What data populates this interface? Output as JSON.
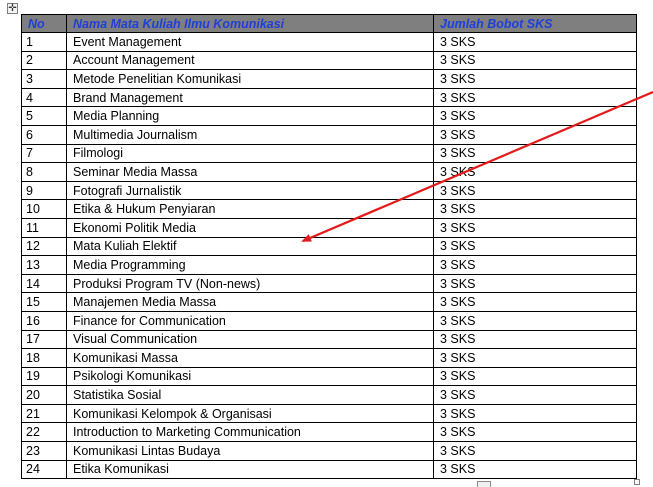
{
  "table": {
    "headers": {
      "no": "No",
      "name": "Nama Mata Kuliah Ilmu Komunikasi",
      "sks": "Jumlah Bobot SKS"
    },
    "rows": [
      {
        "no": "1",
        "name": "Event Management",
        "sks": "3 SKS"
      },
      {
        "no": "2",
        "name": "Account Management",
        "sks": "3 SKS"
      },
      {
        "no": "3",
        "name": "Metode Penelitian Komunikasi",
        "sks": "3 SKS"
      },
      {
        "no": "4",
        "name": "Brand Management",
        "sks": "3 SKS"
      },
      {
        "no": "5",
        "name": "Media Planning",
        "sks": "3 SKS"
      },
      {
        "no": "6",
        "name": "Multimedia Journalism",
        "sks": "3 SKS"
      },
      {
        "no": "7",
        "name": "Filmologi",
        "sks": "3 SKS"
      },
      {
        "no": "8",
        "name": "Seminar Media Massa",
        "sks": "3 SKS"
      },
      {
        "no": "9",
        "name": "Fotografi Jurnalistik",
        "sks": "3 SKS"
      },
      {
        "no": "10",
        "name": "Etika & Hukum Penyiaran",
        "sks": "3 SKS"
      },
      {
        "no": "11",
        "name": "Ekonomi Politik Media",
        "sks": "3 SKS"
      },
      {
        "no": "12",
        "name": "Mata Kuliah Elektif",
        "sks": "3 SKS"
      },
      {
        "no": "13",
        "name": "Media Programming",
        "sks": "3 SKS"
      },
      {
        "no": "14",
        "name": "Produksi Program TV (Non-news)",
        "sks": "3 SKS"
      },
      {
        "no": "15",
        "name": "Manajemen Media Massa",
        "sks": "3 SKS"
      },
      {
        "no": "16",
        "name": "Finance for Communication",
        "sks": "3 SKS"
      },
      {
        "no": "17",
        "name": "Visual Communication",
        "sks": "3 SKS"
      },
      {
        "no": "18",
        "name": "Komunikasi Massa",
        "sks": "3 SKS"
      },
      {
        "no": "19",
        "name": "Psikologi Komunikasi",
        "sks": "3 SKS"
      },
      {
        "no": "20",
        "name": "Statistika Sosial",
        "sks": "3 SKS"
      },
      {
        "no": "21",
        "name": "Komunikasi Kelompok & Organisasi",
        "sks": "3 SKS"
      },
      {
        "no": "22",
        "name": "Introduction to Marketing Communication",
        "sks": "3 SKS"
      },
      {
        "no": "23",
        "name": "Komunikasi Lintas Budaya",
        "sks": "3 SKS"
      },
      {
        "no": "24",
        "name": "Etika Komunikasi",
        "sks": "3 SKS"
      }
    ]
  },
  "colors": {
    "header_bg": "#7f7f7f",
    "header_text": "#1f3fd8",
    "annotation_arrow": "#e41a1a"
  },
  "icons": {
    "move_handle": "move-arrows-icon",
    "annotation": "arrow-annotation-icon"
  }
}
